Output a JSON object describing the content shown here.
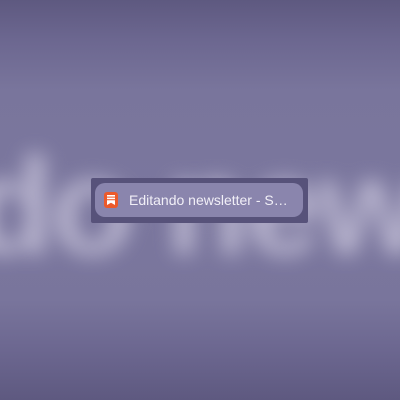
{
  "background": {
    "blurred_text": "do news",
    "color": "#79759c"
  },
  "tab": {
    "title": "Editando newsletter - Substack",
    "favicon": "substack-bookmark-icon",
    "favicon_color": "#ec5a2b"
  }
}
